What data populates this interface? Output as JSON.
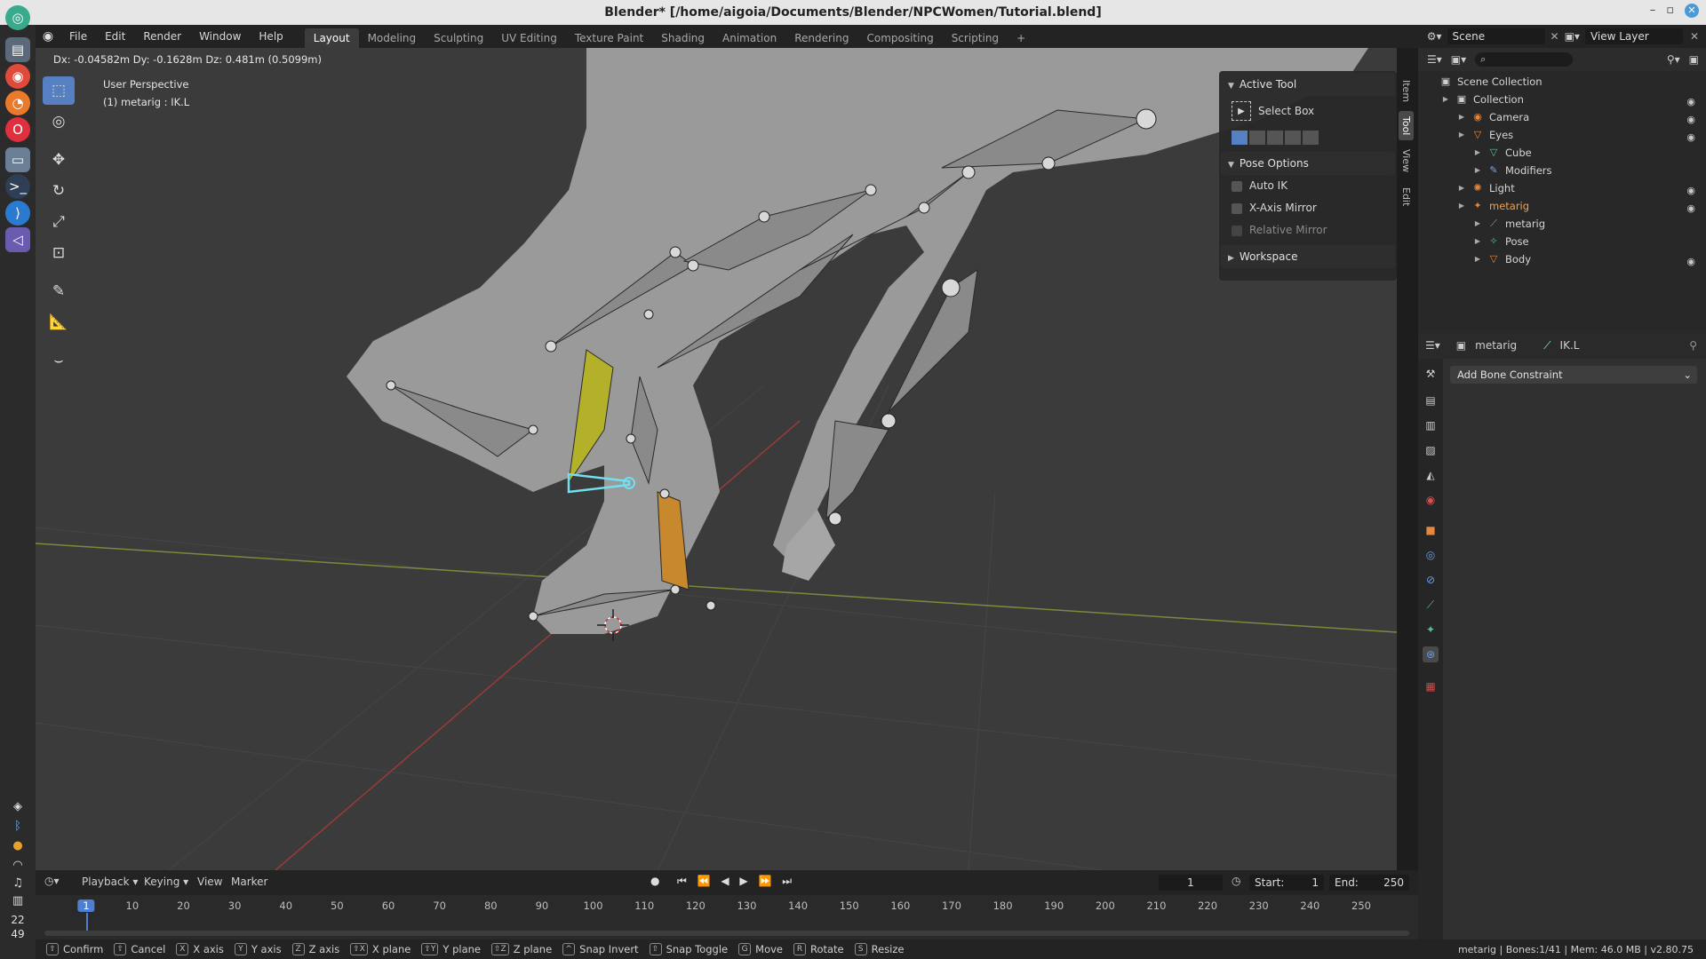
{
  "window": {
    "title": "Blender* [/home/aigoia/Documents/Blender/NPCWomen/Tutorial.blend]",
    "controls": [
      "–",
      "▫",
      "✕"
    ]
  },
  "dock": {
    "time_hour": "22",
    "time_min": "49"
  },
  "menu": [
    "File",
    "Edit",
    "Render",
    "Window",
    "Help"
  ],
  "workspaces": [
    "Layout",
    "Modeling",
    "Sculpting",
    "UV Editing",
    "Texture Paint",
    "Shading",
    "Animation",
    "Rendering",
    "Compositing",
    "Scripting"
  ],
  "active_workspace": "Layout",
  "add_tab": "+",
  "scene": "Scene",
  "view_layer": "View Layer",
  "viewport": {
    "header_text": "Dx: -0.04582m  Dy: -0.1628m  Dz: 0.481m (0.5099m)",
    "perspective": "User Perspective",
    "object_info": "(1) metarig : IK.L"
  },
  "npanel": {
    "active_tool": "Active Tool",
    "select_box": "Select Box",
    "pose_options": "Pose Options",
    "auto_ik": "Auto IK",
    "x_axis_mirror": "X-Axis Mirror",
    "relative_mirror": "Relative Mirror",
    "workspace": "Workspace",
    "tabs": [
      "Item",
      "Tool",
      "View",
      "Edit"
    ]
  },
  "outliner": {
    "rows": [
      {
        "label": "Scene Collection",
        "indent": 0,
        "icon": "▣",
        "color": "#cfcfcf",
        "eye": false
      },
      {
        "label": "Collection",
        "indent": 1,
        "icon": "▣",
        "color": "#cfcfcf",
        "eye": true
      },
      {
        "label": "Camera",
        "indent": 2,
        "icon": "◉",
        "color": "#e8863a",
        "eye": true
      },
      {
        "label": "Eyes",
        "indent": 2,
        "icon": "▽",
        "color": "#e8863a",
        "eye": true
      },
      {
        "label": "Cube",
        "indent": 3,
        "icon": "▽",
        "color": "#58c090",
        "eye": false
      },
      {
        "label": "Modifiers",
        "indent": 3,
        "icon": "✎",
        "color": "#7aa8e0",
        "eye": false
      },
      {
        "label": "Light",
        "indent": 2,
        "icon": "✺",
        "color": "#e8863a",
        "eye": true
      },
      {
        "label": "metarig",
        "indent": 2,
        "icon": "✦",
        "color": "#e8863a",
        "eye": true,
        "selected": true
      },
      {
        "label": "metarig",
        "indent": 3,
        "icon": "⟋",
        "color": "#58c090",
        "eye": false
      },
      {
        "label": "Pose",
        "indent": 3,
        "icon": "✧",
        "color": "#58c090",
        "eye": false
      },
      {
        "label": "Body",
        "indent": 3,
        "icon": "▽",
        "color": "#e8863a",
        "eye": true
      }
    ]
  },
  "properties": {
    "object": "metarig",
    "bone": "IK.L",
    "add_bone_constraint": "Add Bone Constraint"
  },
  "timeline": {
    "menus": [
      "Playback",
      "Keying",
      "View",
      "Marker"
    ],
    "current_frame": "1",
    "start_label": "Start:",
    "start": "1",
    "end_label": "End:",
    "end": "250",
    "ticks": [
      "1",
      "10",
      "20",
      "30",
      "40",
      "50",
      "60",
      "70",
      "80",
      "90",
      "100",
      "110",
      "120",
      "130",
      "140",
      "150",
      "160",
      "170",
      "180",
      "190",
      "200",
      "210",
      "220",
      "230",
      "240",
      "250"
    ]
  },
  "statusbar": {
    "items": [
      {
        "key": "⇧",
        "label": "Confirm"
      },
      {
        "key": "⇧",
        "label": "Cancel"
      },
      {
        "key": "X",
        "label": "X axis"
      },
      {
        "key": "Y",
        "label": "Y axis"
      },
      {
        "key": "Z",
        "label": "Z axis"
      },
      {
        "key": "⇧X",
        "label": "X plane"
      },
      {
        "key": "⇧Y",
        "label": "Y plane"
      },
      {
        "key": "⇧Z",
        "label": "Z plane"
      },
      {
        "key": "^",
        "label": "Snap Invert"
      },
      {
        "key": "⇧",
        "label": "Snap Toggle"
      },
      {
        "key": "G",
        "label": "Move"
      },
      {
        "key": "R",
        "label": "Rotate"
      },
      {
        "key": "S",
        "label": "Resize"
      }
    ],
    "right": "metarig | Bones:1/41 | Mem: 46.0 MB | v2.80.75"
  }
}
